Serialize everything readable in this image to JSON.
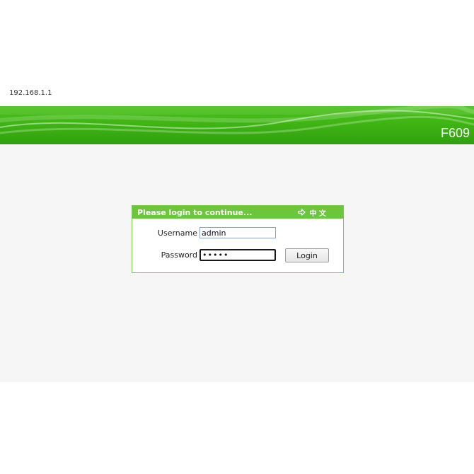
{
  "address": "192.168.1.1",
  "banner": {
    "model": "F609"
  },
  "login": {
    "title": "Please login to continue...",
    "language_link": "中 文",
    "language_icon": "arrow-right-icon",
    "username_label": "Username",
    "username_value": "admin",
    "password_label": "Password",
    "password_value": "•••••",
    "login_button": "Login"
  },
  "colors": {
    "banner_green": "#3fb514",
    "header_green": "#6cc63c",
    "box_border": "#77c94b",
    "content_bg": "#f6f6f6"
  }
}
